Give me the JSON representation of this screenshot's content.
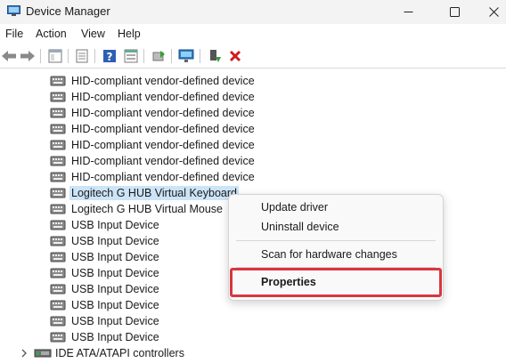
{
  "window": {
    "title": "Device Manager",
    "minimize_icon": "minimize-icon",
    "maximize_icon": "maximize-icon",
    "close_icon": "close-icon"
  },
  "menubar": {
    "items": [
      "File",
      "Action",
      "View",
      "Help"
    ]
  },
  "toolbar": {
    "icons": [
      "back-arrow-icon",
      "forward-arrow-icon",
      "show-hide-tree-icon",
      "properties-icon",
      "help-icon",
      "view-icon",
      "update-driver-icon",
      "monitor-icon",
      "add-device-icon",
      "uninstall-x-icon"
    ]
  },
  "tree": {
    "devices": [
      "HID-compliant vendor-defined device",
      "HID-compliant vendor-defined device",
      "HID-compliant vendor-defined device",
      "HID-compliant vendor-defined device",
      "HID-compliant vendor-defined device",
      "HID-compliant vendor-defined device",
      "HID-compliant vendor-defined device",
      "Logitech G HUB Virtual Keyboard",
      "Logitech G HUB Virtual Mouse",
      "USB Input Device",
      "USB Input Device",
      "USB Input Device",
      "USB Input Device",
      "USB Input Device",
      "USB Input Device",
      "USB Input Device",
      "USB Input Device"
    ],
    "selected_device": "Logitech G HUB Virtual Keyboard",
    "next_category": "IDE ATA/ATAPI controllers"
  },
  "context_menu": {
    "update_driver": "Update driver",
    "uninstall_device": "Uninstall device",
    "scan": "Scan for hardware changes",
    "properties": "Properties"
  },
  "colors": {
    "highlight_border": "#d9363e",
    "selection": "#cce4f7"
  }
}
